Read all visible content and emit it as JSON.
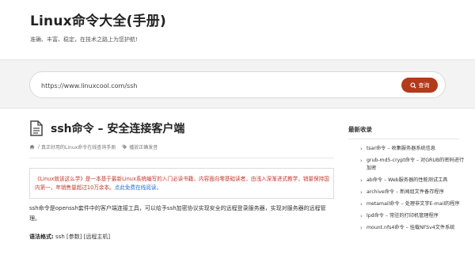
{
  "header": {
    "site_title": "Linux命令大全(手册)",
    "tagline": "准确、丰富、稳定，在技术之路上为您护航!"
  },
  "search": {
    "value": "https://www.linuxcool.com/ssh",
    "button_label": "查询"
  },
  "article": {
    "title": "ssh命令 – 安全连接客户端",
    "breadcrumb_link": "真正好用的Linux命令在线查询手册",
    "breadcrumb_tag": "播放正确发音",
    "notice_text": "《Linux就该这么学》是一本基于最新Linux系统编写的入门必读书籍，内容面向零基础读者，由浅入深渐进式教学，销量保持国内第一，年销售量超过10万余本。",
    "notice_link": "点此免费在线阅读。",
    "description": "ssh命令是openssh套件中的客户端连接工具，可以给予ssh加密协议实现安全的远程登录服务器，实现对服务器的远程管理。",
    "syntax_label": "语法格式:",
    "syntax_value": "ssh [参数] [远程主机]"
  },
  "sidebar": {
    "title": "最新收录",
    "items": [
      "tsar命令 – 收集服务器系统信息",
      "grub-md5-crypt命令 – 对GRUB的密码进行加密",
      "ab命令 – Web服务器的性能测试工具",
      "archive命令 – 新闻组文件备存程序",
      "metamail命令 – 处理非文字E-mail的程序",
      "lpd命令 – 常驻的打印机管理程序",
      "mount.nfs4命令 – 挂载NFSv4文件系统"
    ]
  },
  "colors": {
    "accent": "#b33a1b",
    "notice_text": "#c0392b",
    "link": "#2a6fcf"
  }
}
